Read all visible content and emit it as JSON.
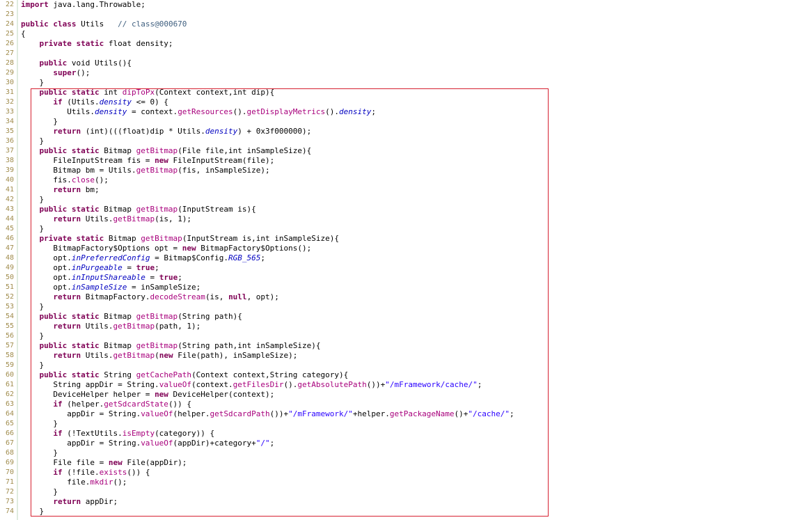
{
  "editor": {
    "highlight_color": "#d62030",
    "keyword_color": "#7f0055",
    "method_color": "#a8007c",
    "string_color": "#2a00ff",
    "line_number_color": "#a08c4c",
    "lines": [
      {
        "n": "22",
        "tokens": [
          {
            "t": "kw",
            "v": "import"
          },
          {
            "t": "p",
            "v": " java.lang.Throwable;"
          }
        ]
      },
      {
        "n": "23",
        "tokens": []
      },
      {
        "n": "24",
        "tokens": [
          {
            "t": "kw",
            "v": "public class"
          },
          {
            "t": "p",
            "v": " Utils   "
          },
          {
            "t": "c",
            "v": "// class@000670"
          }
        ]
      },
      {
        "n": "25",
        "tokens": [
          {
            "t": "p",
            "v": "{"
          }
        ]
      },
      {
        "n": "26",
        "tokens": [
          {
            "t": "p",
            "v": "    "
          },
          {
            "t": "kw",
            "v": "private static"
          },
          {
            "t": "p",
            "v": " float density;"
          }
        ]
      },
      {
        "n": "27",
        "tokens": []
      },
      {
        "n": "28",
        "tokens": [
          {
            "t": "p",
            "v": "    "
          },
          {
            "t": "kw",
            "v": "public"
          },
          {
            "t": "p",
            "v": " void Utils(){"
          }
        ]
      },
      {
        "n": "29",
        "tokens": [
          {
            "t": "p",
            "v": "       "
          },
          {
            "t": "kw",
            "v": "super"
          },
          {
            "t": "p",
            "v": "();"
          }
        ]
      },
      {
        "n": "30",
        "tokens": [
          {
            "t": "p",
            "v": "    }"
          }
        ]
      },
      {
        "n": "31",
        "tokens": [
          {
            "t": "p",
            "v": "    "
          },
          {
            "t": "kw",
            "v": "public static"
          },
          {
            "t": "p",
            "v": " int "
          },
          {
            "t": "m",
            "v": "dipToPx"
          },
          {
            "t": "p",
            "v": "(Context context,int dip){"
          }
        ]
      },
      {
        "n": "32",
        "tokens": [
          {
            "t": "p",
            "v": "       "
          },
          {
            "t": "kw",
            "v": "if"
          },
          {
            "t": "p",
            "v": " (Utils."
          },
          {
            "t": "fs",
            "v": "density"
          },
          {
            "t": "p",
            "v": " <= 0) {"
          }
        ]
      },
      {
        "n": "33",
        "tokens": [
          {
            "t": "p",
            "v": "          Utils."
          },
          {
            "t": "fs",
            "v": "density"
          },
          {
            "t": "p",
            "v": " = context."
          },
          {
            "t": "m",
            "v": "getResources"
          },
          {
            "t": "p",
            "v": "()."
          },
          {
            "t": "m",
            "v": "getDisplayMetrics"
          },
          {
            "t": "p",
            "v": "()."
          },
          {
            "t": "fi",
            "v": "density"
          },
          {
            "t": "p",
            "v": ";"
          }
        ]
      },
      {
        "n": "34",
        "tokens": [
          {
            "t": "p",
            "v": "       }"
          }
        ]
      },
      {
        "n": "35",
        "tokens": [
          {
            "t": "p",
            "v": "       "
          },
          {
            "t": "kw",
            "v": "return"
          },
          {
            "t": "p",
            "v": " (int)(((float)dip * Utils."
          },
          {
            "t": "fs",
            "v": "density"
          },
          {
            "t": "p",
            "v": ") + 0x3f000000);"
          }
        ]
      },
      {
        "n": "36",
        "tokens": [
          {
            "t": "p",
            "v": "    }"
          }
        ]
      },
      {
        "n": "37",
        "tokens": [
          {
            "t": "p",
            "v": "    "
          },
          {
            "t": "kw",
            "v": "public static"
          },
          {
            "t": "p",
            "v": " Bitmap "
          },
          {
            "t": "m",
            "v": "getBitmap"
          },
          {
            "t": "p",
            "v": "(File file,int inSampleSize){"
          }
        ]
      },
      {
        "n": "38",
        "tokens": [
          {
            "t": "p",
            "v": "       FileInputStream fis = "
          },
          {
            "t": "kw",
            "v": "new"
          },
          {
            "t": "p",
            "v": " FileInputStream(file);"
          }
        ]
      },
      {
        "n": "39",
        "tokens": [
          {
            "t": "p",
            "v": "       Bitmap bm = Utils."
          },
          {
            "t": "m",
            "v": "getBitmap"
          },
          {
            "t": "p",
            "v": "(fis, inSampleSize);"
          }
        ]
      },
      {
        "n": "40",
        "tokens": [
          {
            "t": "p",
            "v": "       fis."
          },
          {
            "t": "m",
            "v": "close"
          },
          {
            "t": "p",
            "v": "();"
          }
        ]
      },
      {
        "n": "41",
        "tokens": [
          {
            "t": "p",
            "v": "       "
          },
          {
            "t": "kw",
            "v": "return"
          },
          {
            "t": "p",
            "v": " bm;"
          }
        ]
      },
      {
        "n": "42",
        "tokens": [
          {
            "t": "p",
            "v": "    }"
          }
        ]
      },
      {
        "n": "43",
        "tokens": [
          {
            "t": "p",
            "v": "    "
          },
          {
            "t": "kw",
            "v": "public static"
          },
          {
            "t": "p",
            "v": " Bitmap "
          },
          {
            "t": "m",
            "v": "getBitmap"
          },
          {
            "t": "p",
            "v": "(InputStream is){"
          }
        ]
      },
      {
        "n": "44",
        "tokens": [
          {
            "t": "p",
            "v": "       "
          },
          {
            "t": "kw",
            "v": "return"
          },
          {
            "t": "p",
            "v": " Utils."
          },
          {
            "t": "m",
            "v": "getBitmap"
          },
          {
            "t": "p",
            "v": "(is, 1);"
          }
        ]
      },
      {
        "n": "45",
        "tokens": [
          {
            "t": "p",
            "v": "    }"
          }
        ]
      },
      {
        "n": "46",
        "tokens": [
          {
            "t": "p",
            "v": "    "
          },
          {
            "t": "kw",
            "v": "private static"
          },
          {
            "t": "p",
            "v": " Bitmap "
          },
          {
            "t": "m",
            "v": "getBitmap"
          },
          {
            "t": "p",
            "v": "(InputStream is,int inSampleSize){"
          }
        ]
      },
      {
        "n": "47",
        "tokens": [
          {
            "t": "p",
            "v": "       BitmapFactory$Options opt = "
          },
          {
            "t": "kw",
            "v": "new"
          },
          {
            "t": "p",
            "v": " BitmapFactory$Options();"
          }
        ]
      },
      {
        "n": "48",
        "tokens": [
          {
            "t": "p",
            "v": "       opt."
          },
          {
            "t": "fi",
            "v": "inPreferredConfig"
          },
          {
            "t": "p",
            "v": " = Bitmap$Config."
          },
          {
            "t": "fs",
            "v": "RGB_565"
          },
          {
            "t": "p",
            "v": ";"
          }
        ]
      },
      {
        "n": "49",
        "tokens": [
          {
            "t": "p",
            "v": "       opt."
          },
          {
            "t": "fi",
            "v": "inPurgeable"
          },
          {
            "t": "p",
            "v": " = "
          },
          {
            "t": "kw",
            "v": "true"
          },
          {
            "t": "p",
            "v": ";"
          }
        ]
      },
      {
        "n": "50",
        "tokens": [
          {
            "t": "p",
            "v": "       opt."
          },
          {
            "t": "fi",
            "v": "inInputShareable"
          },
          {
            "t": "p",
            "v": " = "
          },
          {
            "t": "kw",
            "v": "true"
          },
          {
            "t": "p",
            "v": ";"
          }
        ]
      },
      {
        "n": "51",
        "tokens": [
          {
            "t": "p",
            "v": "       opt."
          },
          {
            "t": "fi",
            "v": "inSampleSize"
          },
          {
            "t": "p",
            "v": " = inSampleSize;"
          }
        ]
      },
      {
        "n": "52",
        "tokens": [
          {
            "t": "p",
            "v": "       "
          },
          {
            "t": "kw",
            "v": "return"
          },
          {
            "t": "p",
            "v": " BitmapFactory."
          },
          {
            "t": "m",
            "v": "decodeStream"
          },
          {
            "t": "p",
            "v": "(is, "
          },
          {
            "t": "kw",
            "v": "null"
          },
          {
            "t": "p",
            "v": ", opt);"
          }
        ]
      },
      {
        "n": "53",
        "tokens": [
          {
            "t": "p",
            "v": "    }"
          }
        ]
      },
      {
        "n": "54",
        "tokens": [
          {
            "t": "p",
            "v": "    "
          },
          {
            "t": "kw",
            "v": "public static"
          },
          {
            "t": "p",
            "v": " Bitmap "
          },
          {
            "t": "m",
            "v": "getBitmap"
          },
          {
            "t": "p",
            "v": "(String path){"
          }
        ]
      },
      {
        "n": "55",
        "tokens": [
          {
            "t": "p",
            "v": "       "
          },
          {
            "t": "kw",
            "v": "return"
          },
          {
            "t": "p",
            "v": " Utils."
          },
          {
            "t": "m",
            "v": "getBitmap"
          },
          {
            "t": "p",
            "v": "(path, 1);"
          }
        ]
      },
      {
        "n": "56",
        "tokens": [
          {
            "t": "p",
            "v": "    }"
          }
        ]
      },
      {
        "n": "57",
        "tokens": [
          {
            "t": "p",
            "v": "    "
          },
          {
            "t": "kw",
            "v": "public static"
          },
          {
            "t": "p",
            "v": " Bitmap "
          },
          {
            "t": "m",
            "v": "getBitmap"
          },
          {
            "t": "p",
            "v": "(String path,int inSampleSize){"
          }
        ]
      },
      {
        "n": "58",
        "tokens": [
          {
            "t": "p",
            "v": "       "
          },
          {
            "t": "kw",
            "v": "return"
          },
          {
            "t": "p",
            "v": " Utils."
          },
          {
            "t": "m",
            "v": "getBitmap"
          },
          {
            "t": "p",
            "v": "("
          },
          {
            "t": "kw",
            "v": "new"
          },
          {
            "t": "p",
            "v": " File(path), inSampleSize);"
          }
        ]
      },
      {
        "n": "59",
        "tokens": [
          {
            "t": "p",
            "v": "    }"
          }
        ]
      },
      {
        "n": "60",
        "tokens": [
          {
            "t": "p",
            "v": "    "
          },
          {
            "t": "kw",
            "v": "public static"
          },
          {
            "t": "p",
            "v": " String "
          },
          {
            "t": "m",
            "v": "getCachePath"
          },
          {
            "t": "p",
            "v": "(Context context,String category){"
          }
        ]
      },
      {
        "n": "61",
        "tokens": [
          {
            "t": "p",
            "v": "       String appDir = String."
          },
          {
            "t": "m",
            "v": "valueOf"
          },
          {
            "t": "p",
            "v": "(context."
          },
          {
            "t": "m",
            "v": "getFilesDir"
          },
          {
            "t": "p",
            "v": "()."
          },
          {
            "t": "m",
            "v": "getAbsolutePath"
          },
          {
            "t": "p",
            "v": "())+"
          },
          {
            "t": "s",
            "v": "\"/mFramework/cache/\""
          },
          {
            "t": "p",
            "v": ";"
          }
        ]
      },
      {
        "n": "62",
        "tokens": [
          {
            "t": "p",
            "v": "       DeviceHelper helper = "
          },
          {
            "t": "kw",
            "v": "new"
          },
          {
            "t": "p",
            "v": " DeviceHelper(context);"
          }
        ]
      },
      {
        "n": "63",
        "tokens": [
          {
            "t": "p",
            "v": "       "
          },
          {
            "t": "kw",
            "v": "if"
          },
          {
            "t": "p",
            "v": " (helper."
          },
          {
            "t": "m",
            "v": "getSdcardState"
          },
          {
            "t": "p",
            "v": "()) {"
          }
        ]
      },
      {
        "n": "64",
        "tokens": [
          {
            "t": "p",
            "v": "          appDir = String."
          },
          {
            "t": "m",
            "v": "valueOf"
          },
          {
            "t": "p",
            "v": "(helper."
          },
          {
            "t": "m",
            "v": "getSdcardPath"
          },
          {
            "t": "p",
            "v": "())+"
          },
          {
            "t": "s",
            "v": "\"/mFramework/\""
          },
          {
            "t": "p",
            "v": "+helper."
          },
          {
            "t": "m",
            "v": "getPackageName"
          },
          {
            "t": "p",
            "v": "()+"
          },
          {
            "t": "s",
            "v": "\"/cache/\""
          },
          {
            "t": "p",
            "v": ";"
          }
        ]
      },
      {
        "n": "65",
        "tokens": [
          {
            "t": "p",
            "v": "       }"
          }
        ]
      },
      {
        "n": "66",
        "tokens": [
          {
            "t": "p",
            "v": "       "
          },
          {
            "t": "kw",
            "v": "if"
          },
          {
            "t": "p",
            "v": " (!TextUtils."
          },
          {
            "t": "m",
            "v": "isEmpty"
          },
          {
            "t": "p",
            "v": "(category)) {"
          }
        ]
      },
      {
        "n": "67",
        "tokens": [
          {
            "t": "p",
            "v": "          appDir = String."
          },
          {
            "t": "m",
            "v": "valueOf"
          },
          {
            "t": "p",
            "v": "(appDir)+category+"
          },
          {
            "t": "s",
            "v": "\"/\""
          },
          {
            "t": "p",
            "v": ";"
          }
        ]
      },
      {
        "n": "68",
        "tokens": [
          {
            "t": "p",
            "v": "       }"
          }
        ]
      },
      {
        "n": "69",
        "tokens": [
          {
            "t": "p",
            "v": "       File file = "
          },
          {
            "t": "kw",
            "v": "new"
          },
          {
            "t": "p",
            "v": " File(appDir);"
          }
        ]
      },
      {
        "n": "70",
        "tokens": [
          {
            "t": "p",
            "v": "       "
          },
          {
            "t": "kw",
            "v": "if"
          },
          {
            "t": "p",
            "v": " (!file."
          },
          {
            "t": "m",
            "v": "exists"
          },
          {
            "t": "p",
            "v": "()) {"
          }
        ]
      },
      {
        "n": "71",
        "tokens": [
          {
            "t": "p",
            "v": "          file."
          },
          {
            "t": "m",
            "v": "mkdir"
          },
          {
            "t": "p",
            "v": "();"
          }
        ]
      },
      {
        "n": "72",
        "tokens": [
          {
            "t": "p",
            "v": "       }"
          }
        ]
      },
      {
        "n": "73",
        "tokens": [
          {
            "t": "p",
            "v": "       "
          },
          {
            "t": "kw",
            "v": "return"
          },
          {
            "t": "p",
            "v": " appDir;"
          }
        ]
      },
      {
        "n": "74",
        "tokens": [
          {
            "t": "p",
            "v": "    }"
          }
        ]
      }
    ]
  }
}
